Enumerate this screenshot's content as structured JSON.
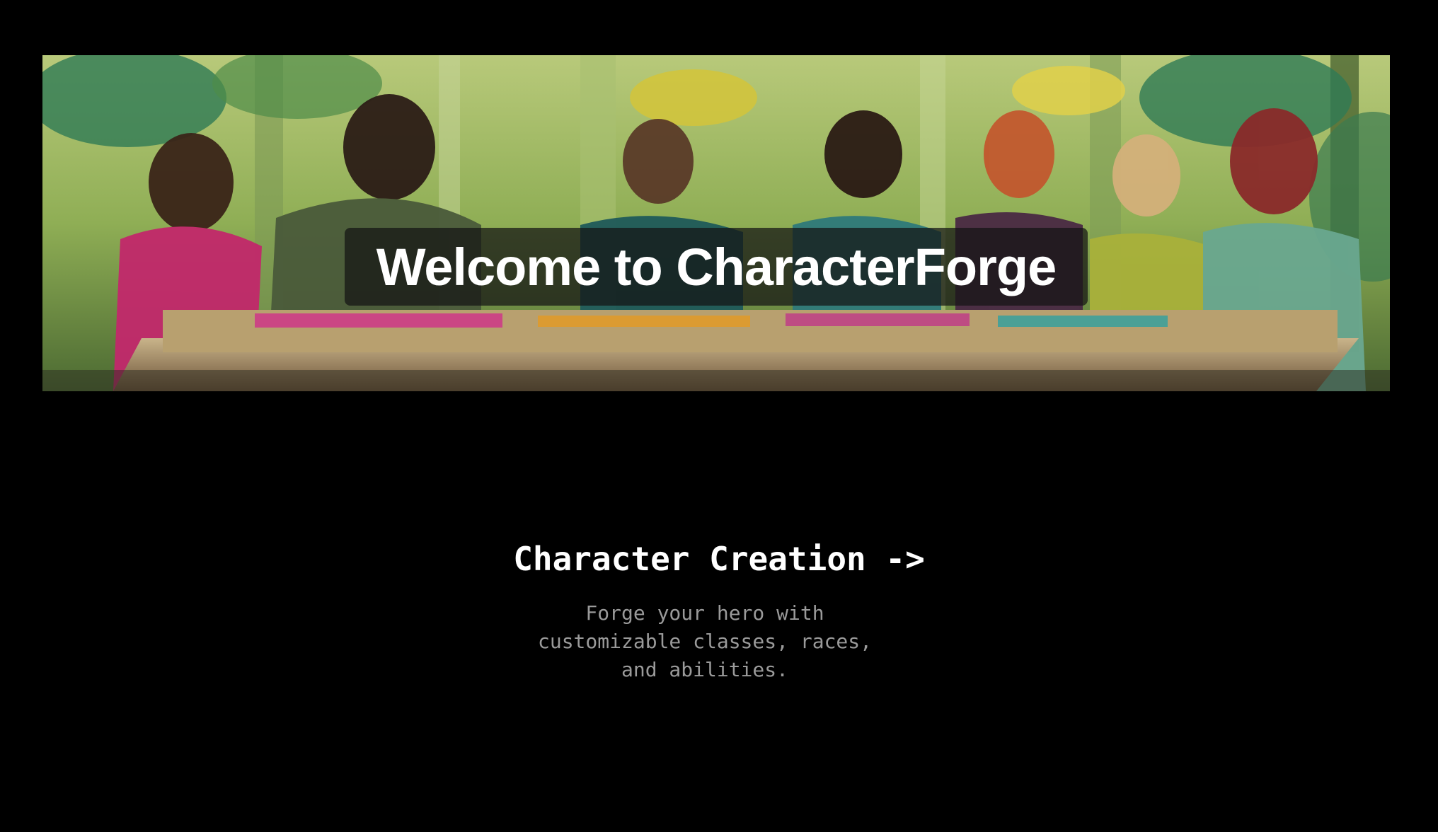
{
  "hero": {
    "title": "Welcome to CharacterForge",
    "image_alt": "Illustrated group of adventurers gathered around a wooden table in a sunlit forest"
  },
  "feature": {
    "heading": "Character Creation ->",
    "description": "Forge your hero with customizable classes, races, and abilities."
  },
  "colors": {
    "background": "#000000",
    "heading_text": "#ffffff",
    "description_text": "#9a9a9a",
    "title_box": "rgba(20,20,20,0.72)"
  }
}
